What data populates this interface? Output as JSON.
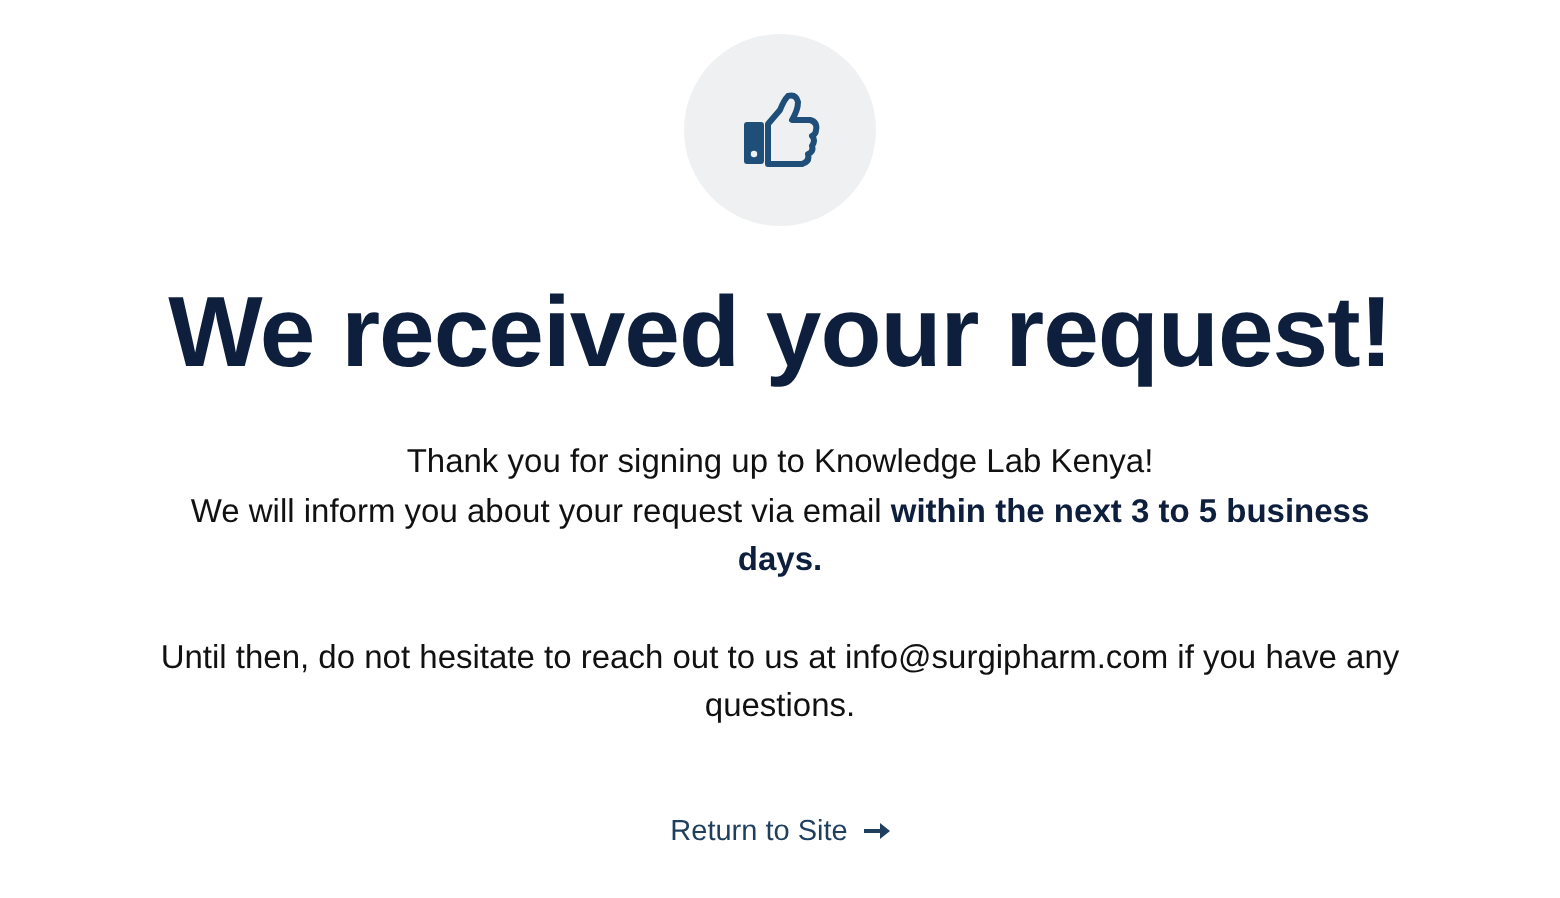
{
  "heading": "We received your request!",
  "paragraphs": [
    {
      "lines": [
        "Thank you for signing up to Knowledge Lab Kenya!",
        "We will inform you about your request via email **within the next 3 to 5 business days.**"
      ]
    },
    {
      "lines": [
        "Until then, do not hesitate to reach out to us at info@surgipharm.com if you have any questions."
      ]
    }
  ],
  "link": {
    "label": "Return to Site"
  }
}
